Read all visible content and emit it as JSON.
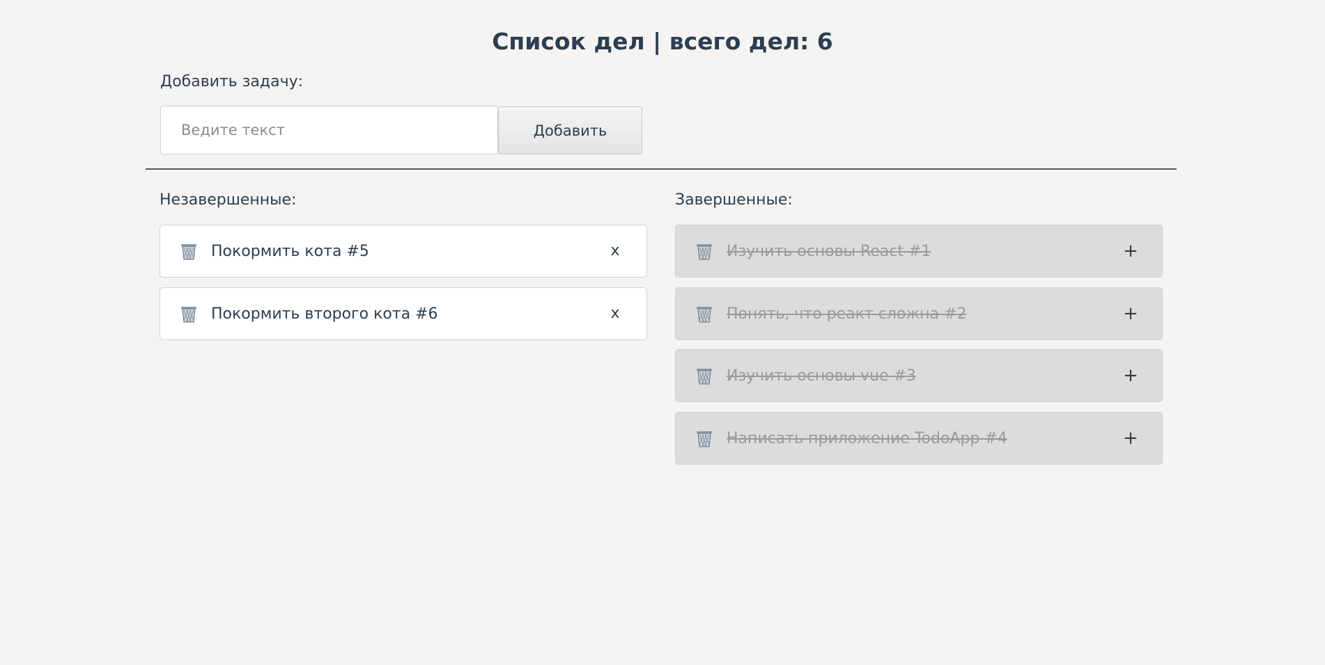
{
  "header": {
    "title": "Список дел | всего дел: 6"
  },
  "add_form": {
    "label": "Добавить задачу:",
    "input_value": "",
    "input_placeholder": "Ведите текст",
    "button_label": "Добавить"
  },
  "incomplete": {
    "label": "Незавершенные:",
    "items": [
      {
        "text": "Покормить кота #5",
        "action": "x",
        "icon": "trash-basket-icon"
      },
      {
        "text": "Покормить второго кота #6",
        "action": "x",
        "icon": "trash-basket-icon"
      }
    ]
  },
  "completed": {
    "label": "Завершенные:",
    "items": [
      {
        "text": "Изучить основы React #1",
        "action": "+",
        "icon": "trash-basket-icon"
      },
      {
        "text": "Понять, что реакт сложна #2",
        "action": "+",
        "icon": "trash-basket-icon"
      },
      {
        "text": "Изучить основы vue #3",
        "action": "+",
        "icon": "trash-basket-icon"
      },
      {
        "text": "Написать приложение TodoApp #4",
        "action": "+",
        "icon": "trash-basket-icon"
      }
    ]
  },
  "colors": {
    "background": "#f5f4f2",
    "text": "#2c3e50",
    "completed_card": "#dddcda",
    "completed_text": "#9a9a9a"
  }
}
